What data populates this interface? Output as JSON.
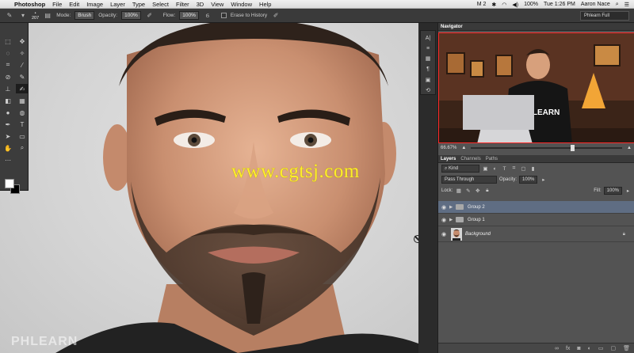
{
  "menubar": {
    "app_name": "Photoshop",
    "menus": [
      "File",
      "Edit",
      "Image",
      "Layer",
      "Type",
      "Select",
      "Filter",
      "3D",
      "View",
      "Window",
      "Help"
    ],
    "status": {
      "m2": "M 2",
      "battery": "100%",
      "clock": "Tue 1:26 PM",
      "user": "Aaron Nace"
    }
  },
  "options": {
    "brush_size": "207",
    "mode_label": "Mode:",
    "mode_value": "Brush",
    "opacity_label": "Opacity:",
    "opacity_value": "100%",
    "flow_label": "Flow:",
    "flow_value": "100%",
    "erase_history_label": "Erase to History",
    "workspace": "Phlearn Full"
  },
  "navigator": {
    "tab": "Navigator",
    "zoom": "66.67%",
    "zoom_fraction": 0.6667
  },
  "layers_panel": {
    "tabs": [
      "Layers",
      "Channels",
      "Paths"
    ],
    "filter_kind": "Kind",
    "blend_mode": "Pass Through",
    "opacity_label": "Opacity:",
    "opacity_value": "100%",
    "lock_label": "Lock:",
    "fill_label": "Fill:",
    "fill_value": "100%",
    "layers": [
      {
        "name": "Group 2",
        "type": "group",
        "selected": true
      },
      {
        "name": "Group 1",
        "type": "group",
        "selected": false
      },
      {
        "name": "Background",
        "type": "image",
        "selected": false,
        "locked": true
      }
    ]
  },
  "canvas": {
    "watermark": "www.cgtsj.com",
    "logo_text": "PHLEARN"
  },
  "colors": {
    "selection": "#5f6d83",
    "panel_bg": "#535353",
    "watermark": "#ffef2a"
  }
}
